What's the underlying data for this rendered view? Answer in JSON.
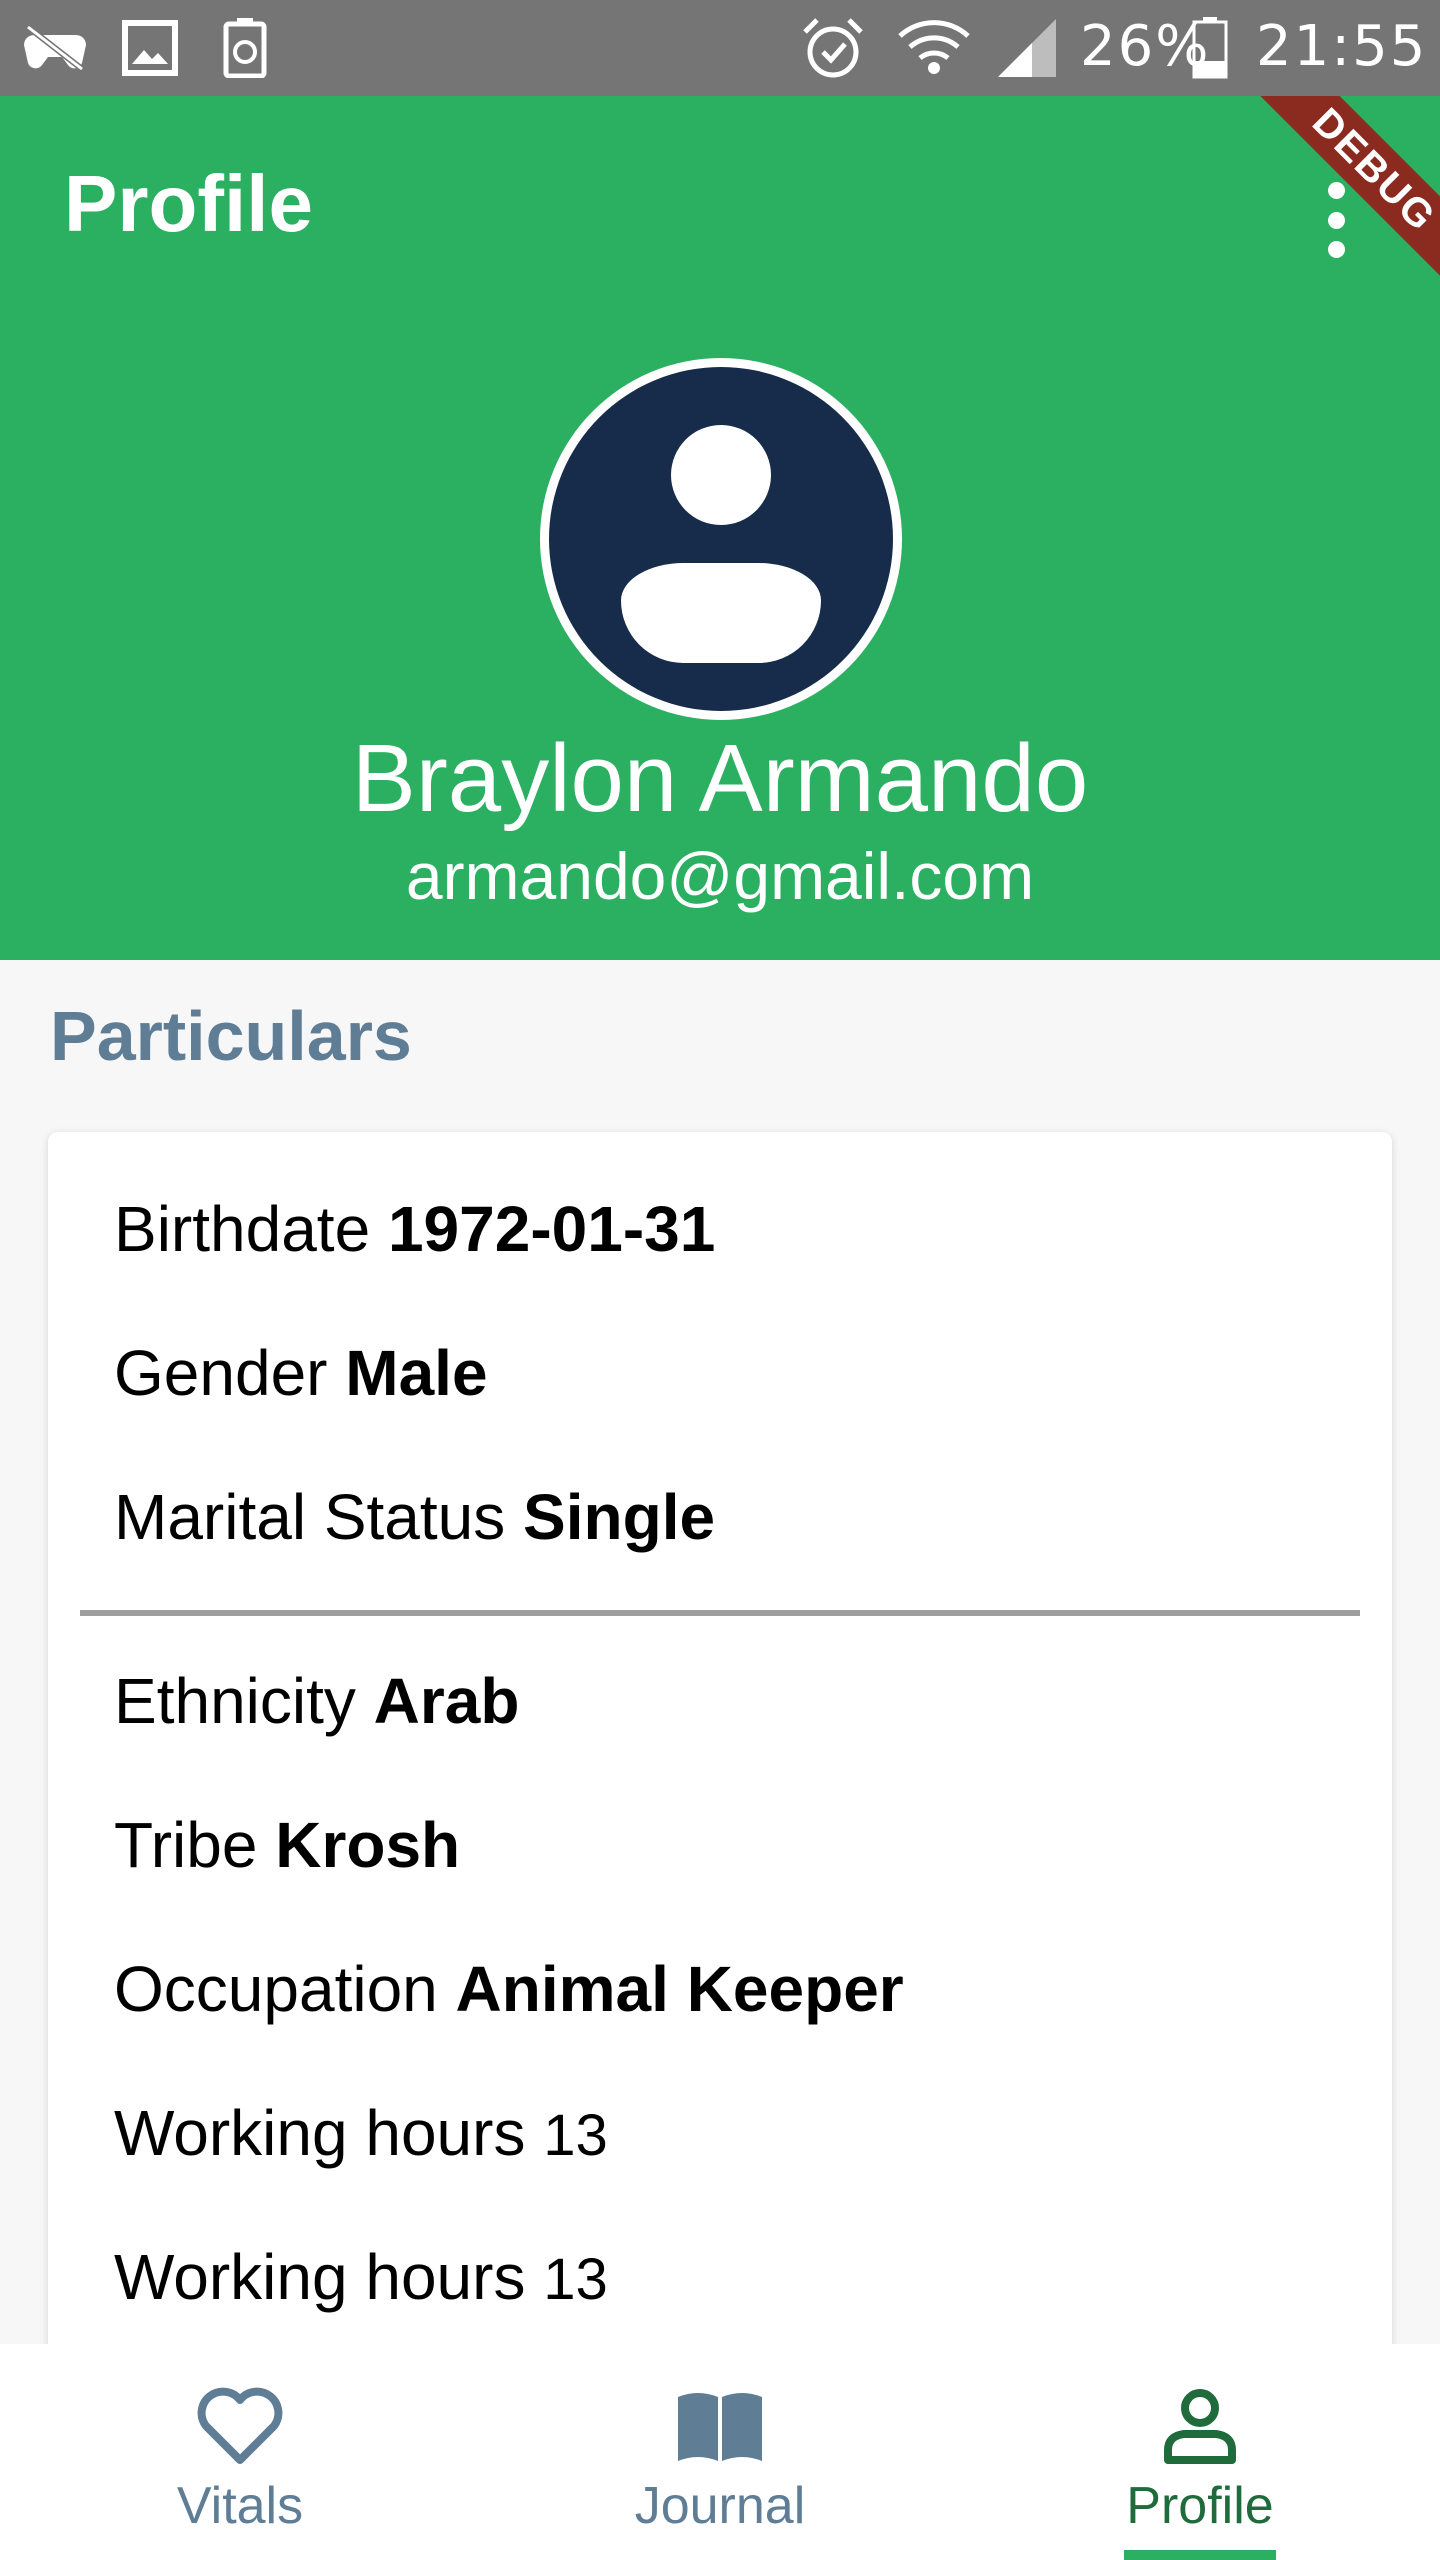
{
  "status_bar": {
    "battery": "26%",
    "time": "21:55",
    "icons": [
      "game-controller-icon",
      "image-icon",
      "battery-saver-icon",
      "alarm-icon",
      "wifi-icon",
      "signal-icon",
      "battery-icon"
    ]
  },
  "app_bar": {
    "title": "Profile",
    "debug_banner": "DEBUG",
    "menu_icon": "more-vert-icon"
  },
  "profile": {
    "name": "Braylon Armando",
    "email": "armando@gmail.com"
  },
  "particulars": {
    "title": "Particulars",
    "birthdate_label": "Birthdate",
    "birthdate_value": "1972-01-31",
    "gender_label": "Gender",
    "gender_value": "Male",
    "marital_label": "Marital Status",
    "marital_value": "Single",
    "ethnicity_label": "Ethnicity",
    "ethnicity_value": "Arab",
    "tribe_label": "Tribe",
    "tribe_value": "Krosh",
    "occupation_label": "Occupation",
    "occupation_value": "Animal Keeper",
    "hours1_label": "Working hours",
    "hours1_value": "13",
    "hours2_label": "Working hours",
    "hours2_value": "13"
  },
  "bottom_nav": {
    "items": [
      {
        "label": "Vitals",
        "icon": "heart-icon"
      },
      {
        "label": "Journal",
        "icon": "book-icon"
      },
      {
        "label": "Profile",
        "icon": "person-icon"
      }
    ],
    "active": "Profile"
  },
  "colors": {
    "primary_green": "#2bb062",
    "avatar_navy": "#162c4a",
    "section_blue_gray": "#5f7d95",
    "active_nav": "#1f6b3c",
    "status_bar": "#757575"
  }
}
